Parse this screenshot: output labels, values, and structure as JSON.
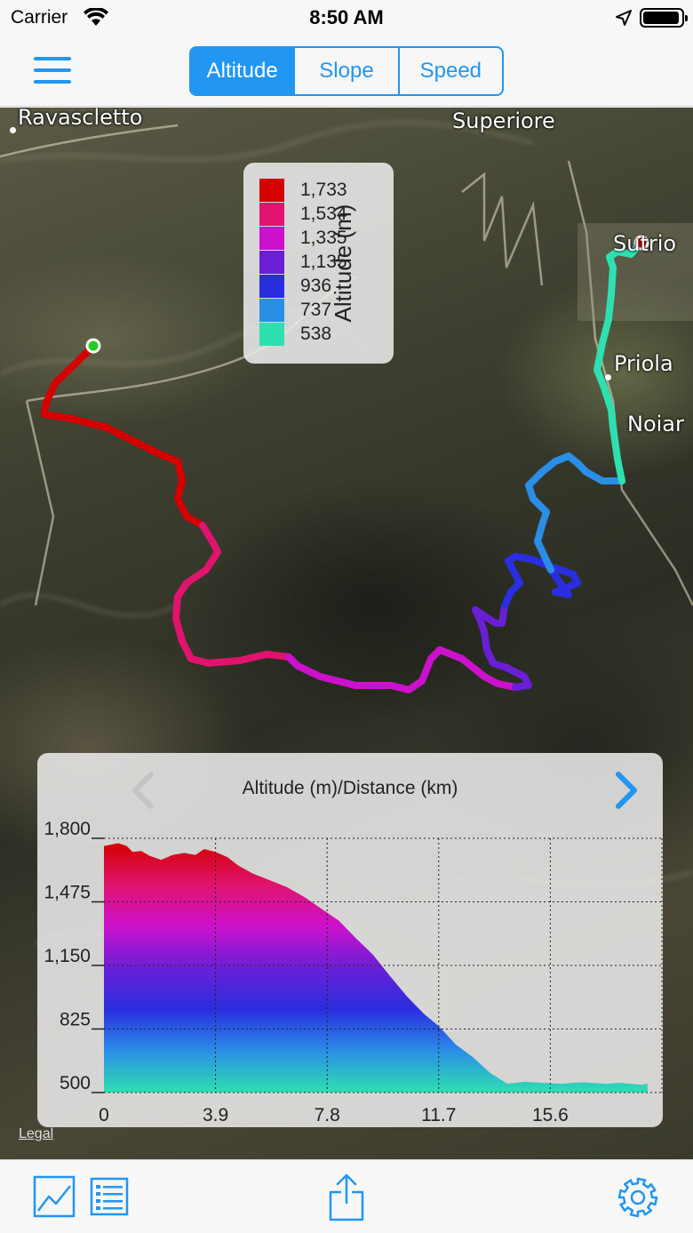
{
  "status_bar": {
    "carrier": "Carrier",
    "time": "8:50 AM",
    "wifi_icon": "wifi-icon",
    "location_icon": "location-arrow-icon",
    "battery_icon": "battery-icon"
  },
  "nav": {
    "menu_icon": "hamburger-menu-icon",
    "segments": [
      {
        "label": "Altitude",
        "active": true
      },
      {
        "label": "Slope",
        "active": false
      },
      {
        "label": "Speed",
        "active": false
      }
    ],
    "accent_color": "#2196f3"
  },
  "map": {
    "places": [
      "Ravascletto",
      "Superiore",
      "Sutrio",
      "Priola",
      "Noiar"
    ],
    "legal_link": "Legal",
    "start_marker_color": "#22cc22",
    "end_marker_color": "#e01010"
  },
  "legend": {
    "title": "Altitude (m)",
    "items": [
      {
        "label": "1,733",
        "color": "#d50000"
      },
      {
        "label": "1,534",
        "color": "#e0136e"
      },
      {
        "label": "1,335",
        "color": "#cc11cc"
      },
      {
        "label": "1,135",
        "color": "#6a1fd6"
      },
      {
        "label": "936",
        "color": "#2a2ee0"
      },
      {
        "label": "737",
        "color": "#2a8ee6"
      },
      {
        "label": "538",
        "color": "#2ee0b0"
      }
    ]
  },
  "chart_data": {
    "type": "area",
    "title": "Altitude (m)/Distance (km)",
    "xlabel": "Distance (km)",
    "ylabel": "Altitude (m)",
    "x_ticks": [
      "0",
      "3.9",
      "7.8",
      "11.7",
      "15.6"
    ],
    "y_ticks": [
      "1,800",
      "1,475",
      "1,150",
      "825",
      "500"
    ],
    "xlim": [
      0,
      19.5
    ],
    "ylim": [
      500,
      1800
    ],
    "grid": true,
    "x": [
      0,
      0.5,
      0.8,
      1.0,
      1.3,
      1.6,
      2.0,
      2.4,
      2.8,
      3.2,
      3.5,
      3.9,
      4.3,
      4.7,
      5.2,
      5.8,
      6.4,
      7.0,
      7.6,
      8.2,
      8.8,
      9.4,
      10.0,
      10.6,
      11.2,
      11.7,
      12.3,
      12.9,
      13.5,
      14.1,
      14.7,
      15.3,
      15.6,
      16.0,
      16.4,
      16.8,
      17.2,
      17.6,
      18.0,
      18.4,
      18.8,
      19.0
    ],
    "values": [
      1760,
      1775,
      1760,
      1730,
      1735,
      1710,
      1690,
      1715,
      1725,
      1715,
      1745,
      1730,
      1705,
      1660,
      1620,
      1585,
      1550,
      1500,
      1440,
      1380,
      1290,
      1205,
      1095,
      990,
      900,
      840,
      745,
      680,
      600,
      545,
      555,
      550,
      548,
      545,
      550,
      552,
      548,
      545,
      550,
      545,
      540,
      545
    ]
  },
  "toolbar": {
    "chart_icon": "line-chart-icon",
    "list_icon": "list-icon",
    "share_icon": "share-icon",
    "settings_icon": "gear-icon"
  }
}
